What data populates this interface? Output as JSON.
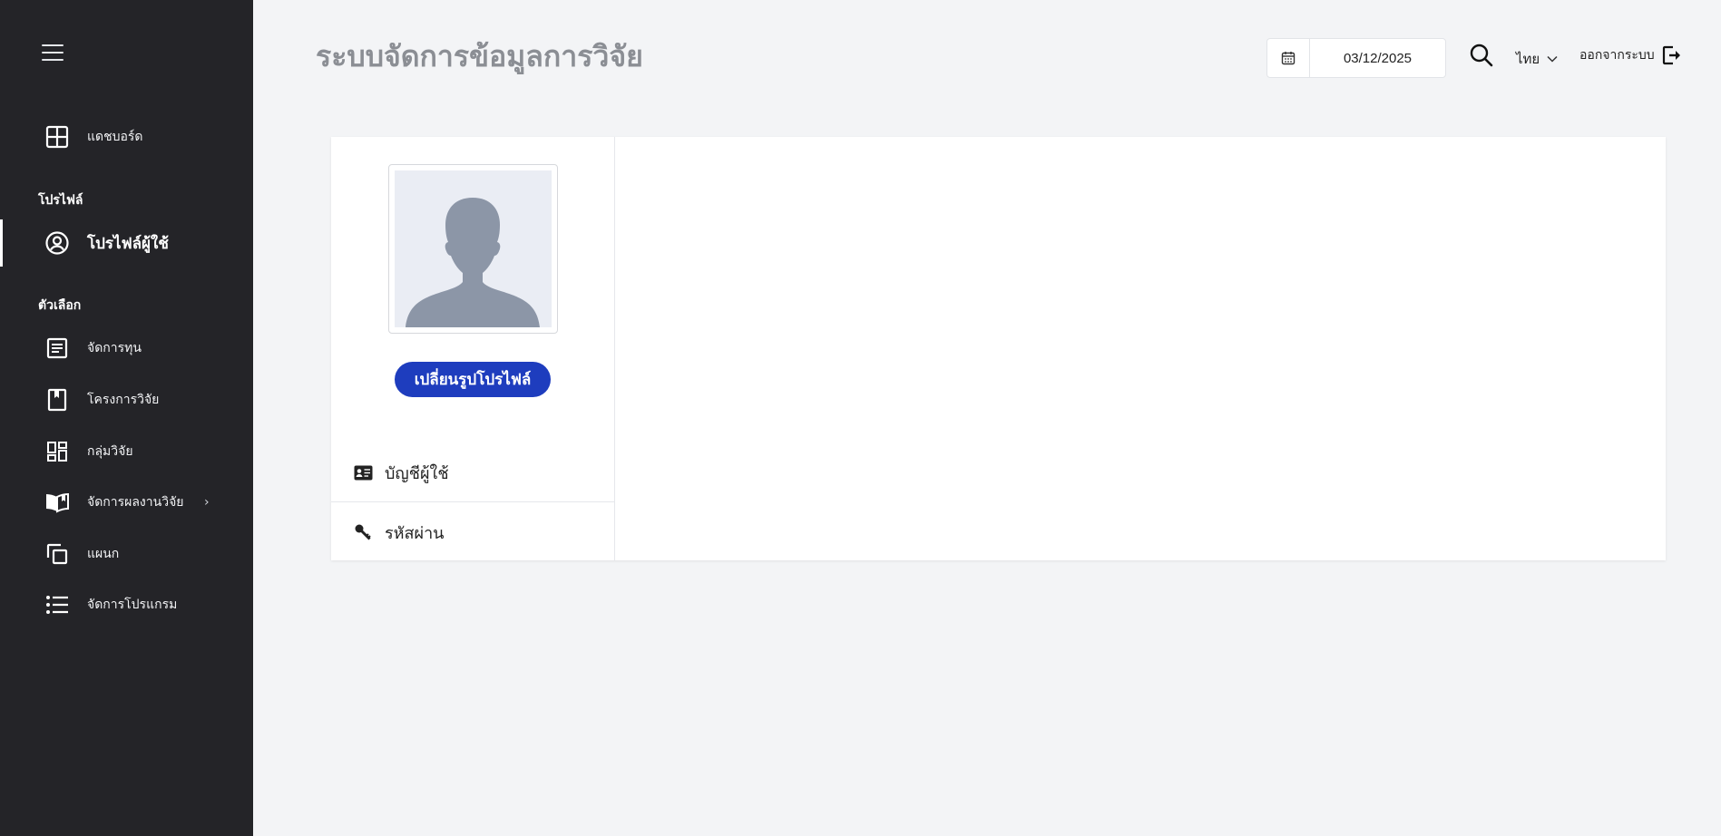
{
  "header": {
    "title": "ระบบจัดการข้อมูลการวิจัย",
    "date": "03/12/2025",
    "language": "ไทย",
    "logout_label": "ออกจากระบบ"
  },
  "sidebar": {
    "dashboard": "แดชบอร์ด",
    "section_profile": "โปรไฟล์",
    "user_profile": "โปรไฟล์ผู้ใช้",
    "section_options": "ตัวเลือก",
    "items": [
      {
        "label": "จัดการทุน",
        "icon": "document-list-icon"
      },
      {
        "label": "โครงการวิจัย",
        "icon": "bookmark-icon"
      },
      {
        "label": "กลุ่มวิจัย",
        "icon": "dashboard-grid-icon"
      },
      {
        "label": "จัดการผลงานวิจัย",
        "icon": "open-book-icon"
      },
      {
        "label": "แผนก",
        "icon": "copy-icon"
      },
      {
        "label": "จัดการโปรแกรม",
        "icon": "list-icon"
      }
    ]
  },
  "profile_card": {
    "change_photo_label": "เปลี่ยนรูปโปรไฟล์",
    "menu": [
      {
        "label": "บัญชีผู้ใช้",
        "icon": "id-card-icon"
      },
      {
        "label": "รหัสผ่าน",
        "icon": "key-icon"
      }
    ]
  },
  "colors": {
    "sidebar_bg": "#242428",
    "primary_button": "#1e3dbe",
    "page_bg": "#f3f4f6"
  }
}
